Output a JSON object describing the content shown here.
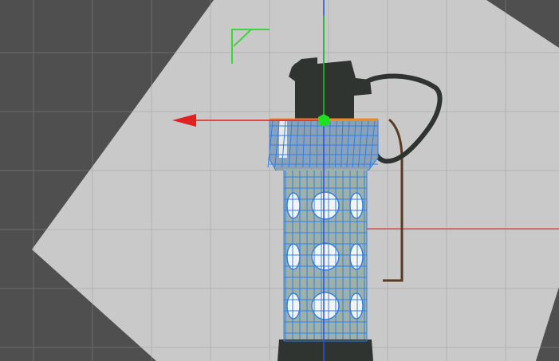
{
  "viewport": {
    "background_color": "#4f4f4f",
    "grid_color": "#6b6b6b",
    "reference_plane_color": "#c9c9c9",
    "grid_light_color": "#b3b3b3"
  },
  "gizmo": {
    "x_axis_color": "#e32020",
    "y_axis_color": "#18c418",
    "z_axis_color": "#2a4de8",
    "pivot_color": "#1fe01f",
    "corner_marker_color": "#3ed43e"
  },
  "model": {
    "body_color": "#2f3430",
    "wireframe_color": "#2f7fe8",
    "selected_edge_color": "#f08a1e",
    "pin_color": "#5a3a22",
    "hole_color": "#f4f4f4"
  }
}
